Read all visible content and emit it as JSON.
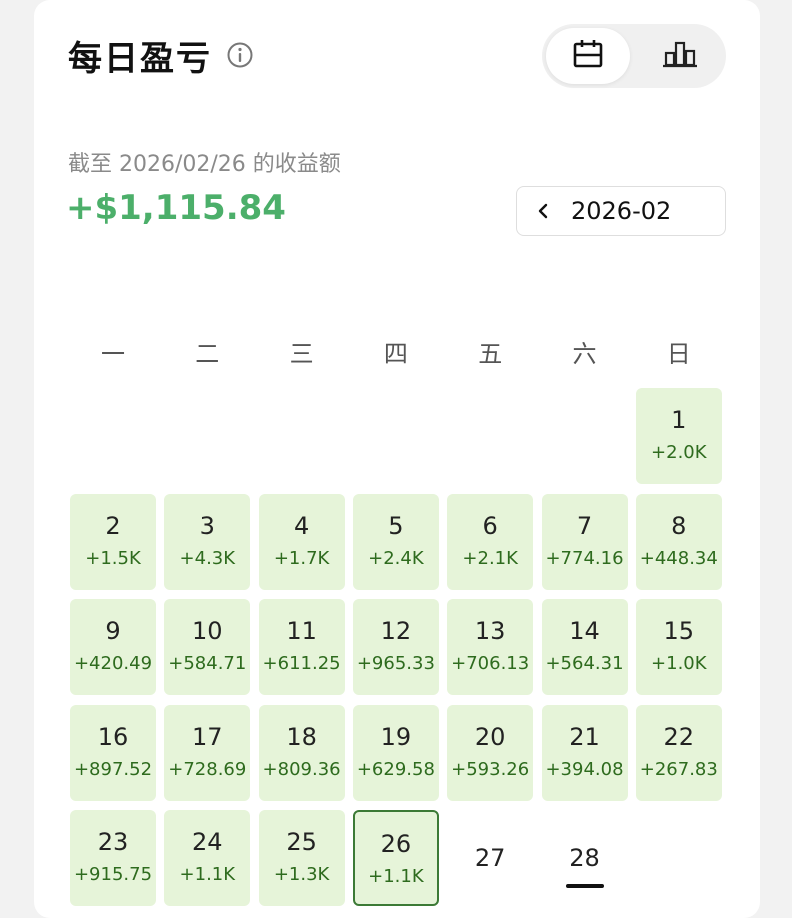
{
  "header": {
    "title": "每日盈亏",
    "info_icon": "info-icon",
    "view_toggle": [
      {
        "name": "calendar-icon",
        "active": true
      },
      {
        "name": "bar-chart-icon",
        "active": false
      }
    ]
  },
  "summary": {
    "subtitle": "截至 2026/02/26 的收益额",
    "total": "+$1,115.84",
    "total_color": "#4caf6a"
  },
  "month_picker": {
    "label": "2026-02",
    "prev_icon": "chevron-left-icon"
  },
  "weekdays": [
    "一",
    "二",
    "三",
    "四",
    "五",
    "六",
    "日"
  ],
  "calendar": {
    "first_weekday_index": 6,
    "selected_day": 26,
    "days": [
      {
        "day": "1",
        "pnl": "+2.0K"
      },
      {
        "day": "2",
        "pnl": "+1.5K"
      },
      {
        "day": "3",
        "pnl": "+4.3K"
      },
      {
        "day": "4",
        "pnl": "+1.7K"
      },
      {
        "day": "5",
        "pnl": "+2.4K"
      },
      {
        "day": "6",
        "pnl": "+2.1K"
      },
      {
        "day": "7",
        "pnl": "+774.16"
      },
      {
        "day": "8",
        "pnl": "+448.34"
      },
      {
        "day": "9",
        "pnl": "+420.49"
      },
      {
        "day": "10",
        "pnl": "+584.71"
      },
      {
        "day": "11",
        "pnl": "+611.25"
      },
      {
        "day": "12",
        "pnl": "+965.33"
      },
      {
        "day": "13",
        "pnl": "+706.13"
      },
      {
        "day": "14",
        "pnl": "+564.31"
      },
      {
        "day": "15",
        "pnl": "+1.0K"
      },
      {
        "day": "16",
        "pnl": "+897.52"
      },
      {
        "day": "17",
        "pnl": "+728.69"
      },
      {
        "day": "18",
        "pnl": "+809.36"
      },
      {
        "day": "19",
        "pnl": "+629.58"
      },
      {
        "day": "20",
        "pnl": "+593.26"
      },
      {
        "day": "21",
        "pnl": "+394.08"
      },
      {
        "day": "22",
        "pnl": "+267.83"
      },
      {
        "day": "23",
        "pnl": "+915.75"
      },
      {
        "day": "24",
        "pnl": "+1.1K"
      },
      {
        "day": "25",
        "pnl": "+1.3K"
      },
      {
        "day": "26",
        "pnl": "+1.1K"
      },
      {
        "day": "27",
        "pnl": ""
      },
      {
        "day": "28",
        "pnl": "",
        "today": true
      }
    ]
  },
  "colors": {
    "profit_cell_bg": "#e6f4d9",
    "profit_text": "#2e6b1e",
    "selected_border": "#3c7a36"
  }
}
